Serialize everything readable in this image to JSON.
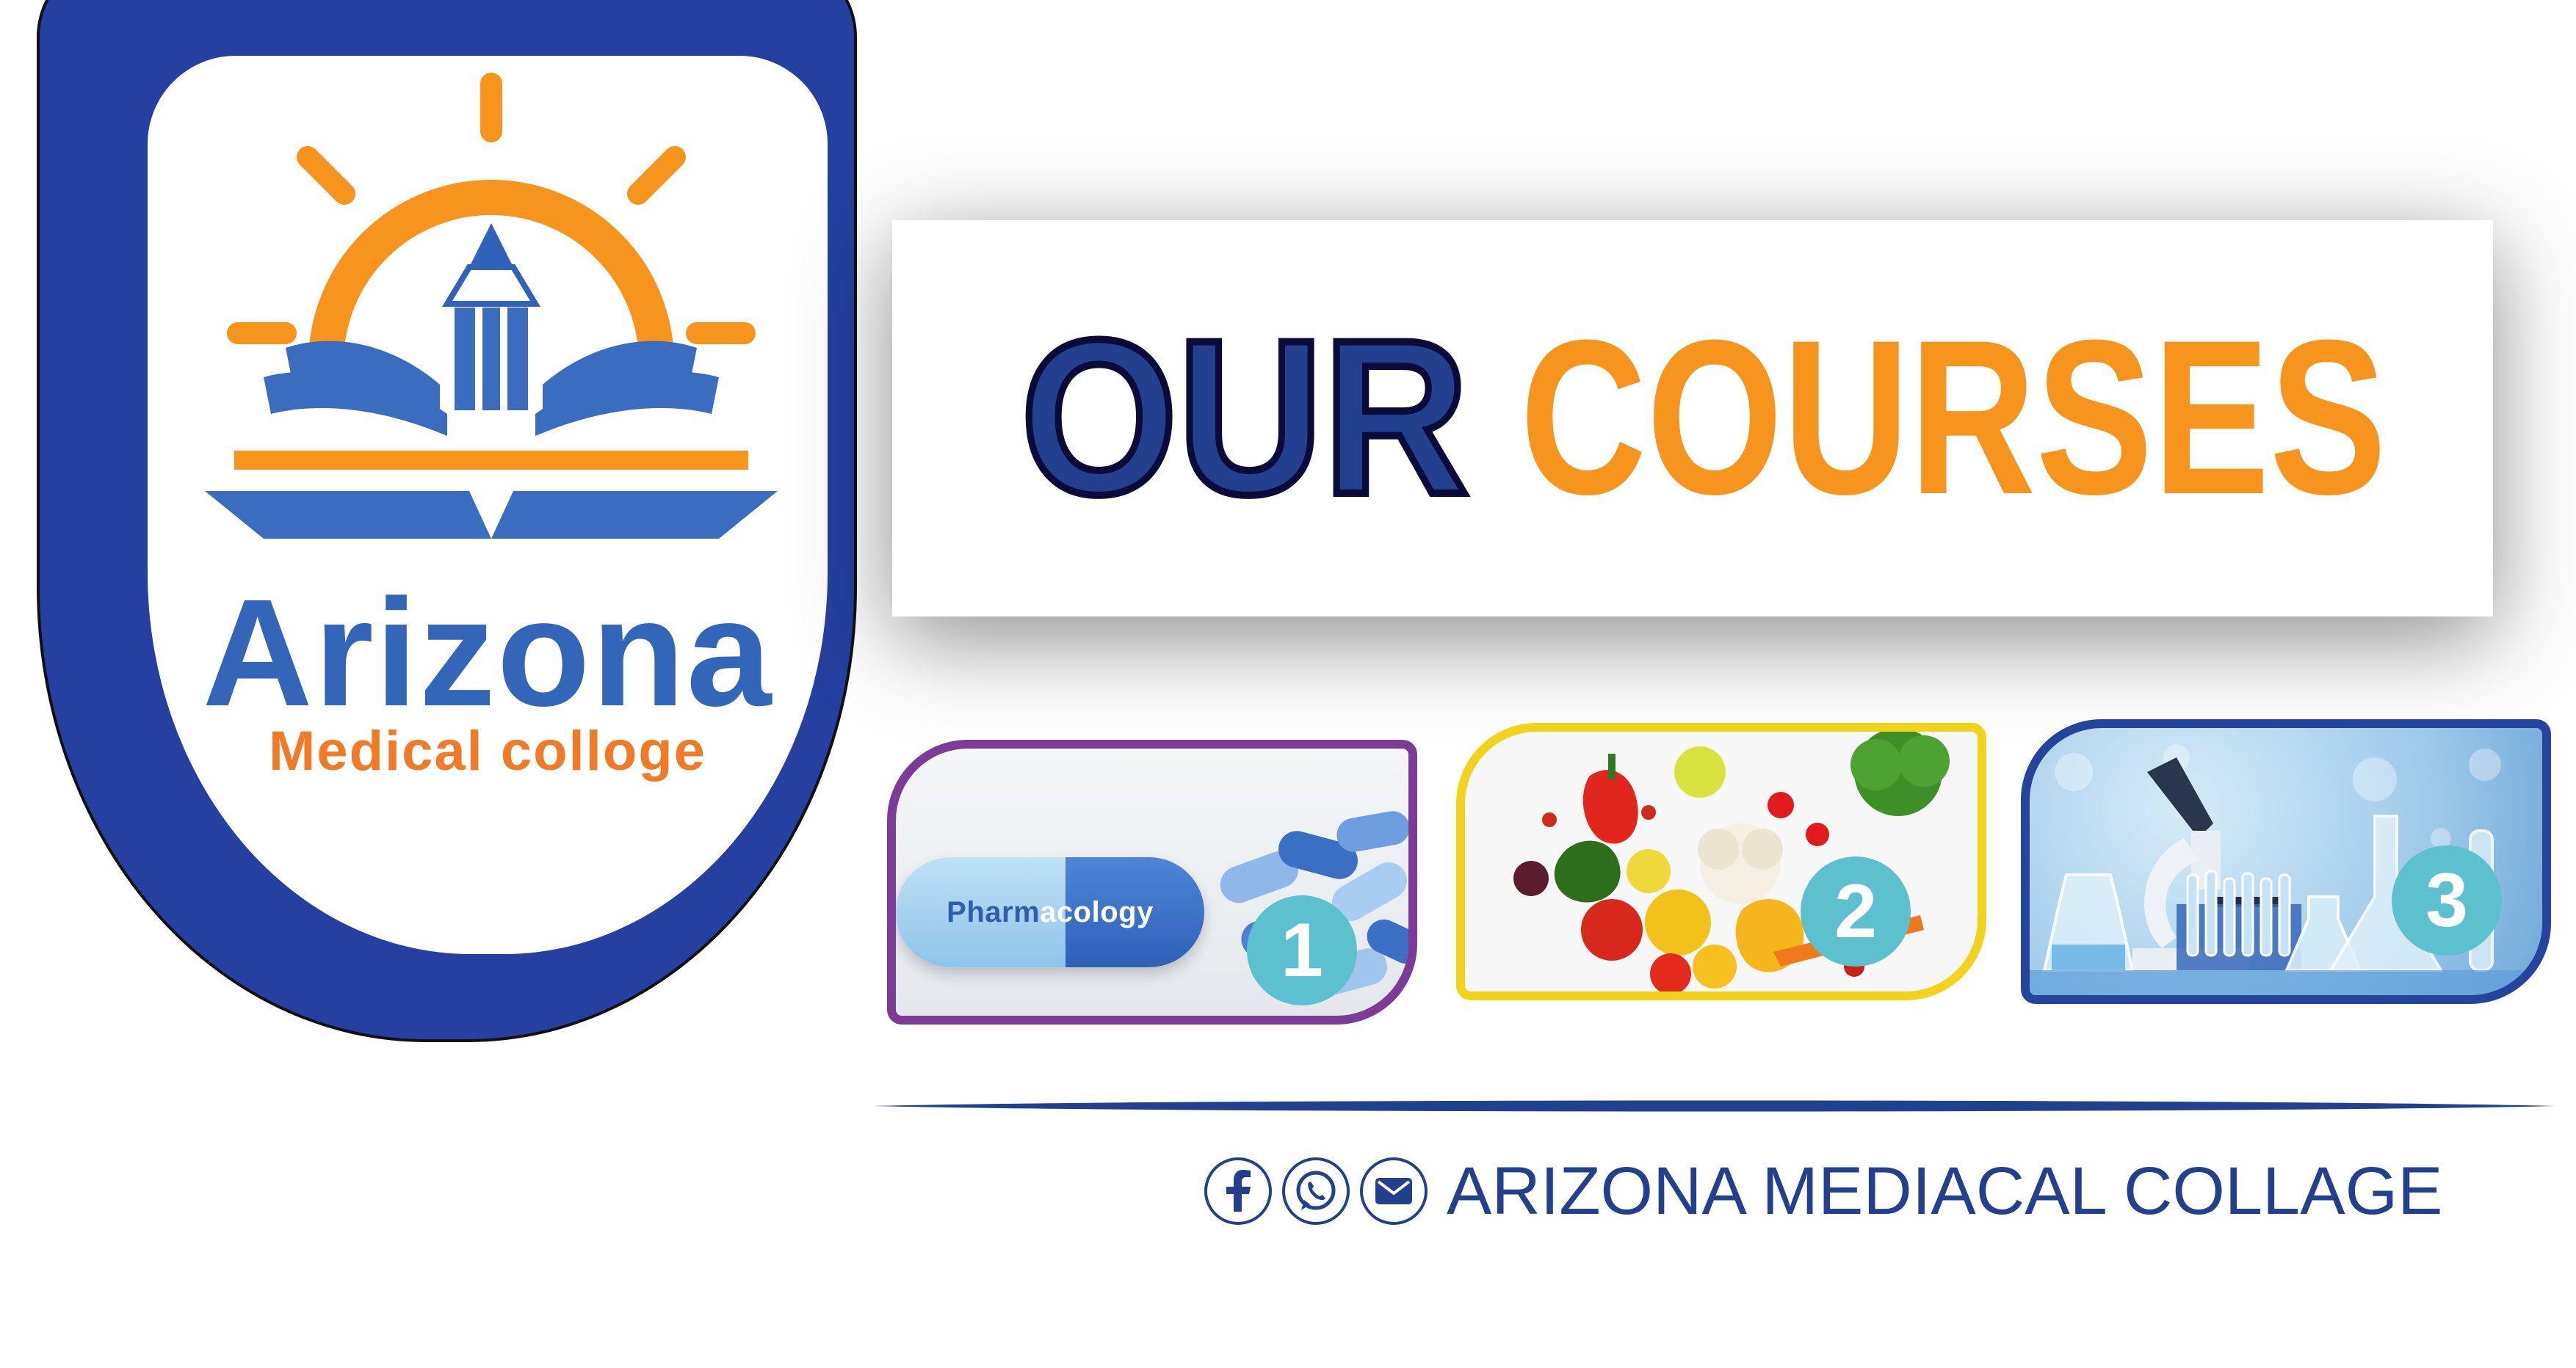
{
  "logo": {
    "name": "Arizona",
    "subtitle": "Medical colloge",
    "emblem_icon": "sun-pencil-book-icon"
  },
  "banner": {
    "title_part1": "OUR",
    "title_part2": "COURSES"
  },
  "courses": [
    {
      "number": "1",
      "label_start": "Pharm",
      "label_end": "acology",
      "image_icon": "capsule-pills-icon"
    },
    {
      "number": "2",
      "image_icon": "vegetables-icon"
    },
    {
      "number": "3",
      "image_icon": "microscope-lab-icon"
    }
  ],
  "footer": {
    "icons": [
      "facebook-icon",
      "whatsapp-icon",
      "email-icon"
    ],
    "text": "ARIZONA MEDIACAL COLLAGE"
  },
  "colors": {
    "brand_blue": "#2540a0",
    "light_blue": "#3366b8",
    "orange": "#f7941d",
    "orange_text": "#f07a25",
    "purple_frame": "#7c3b96",
    "yellow_frame": "#f3d21b",
    "teal_badge": "#5cc0cf"
  }
}
